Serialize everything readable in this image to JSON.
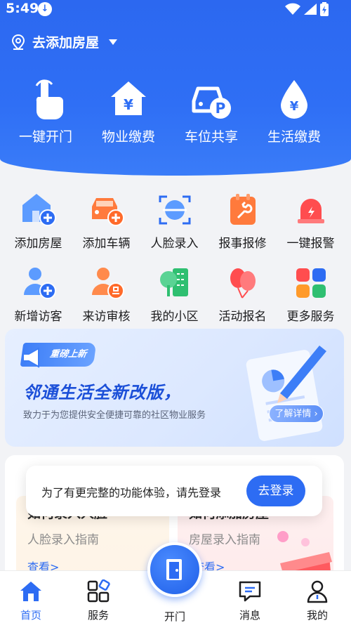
{
  "status": {
    "time": "5:49"
  },
  "header": {
    "location": "去添加房屋"
  },
  "quick_actions": [
    {
      "label": "一键开门",
      "icon": "hand-tap-icon"
    },
    {
      "label": "物业缴费",
      "icon": "house-yen-icon"
    },
    {
      "label": "车位共享",
      "icon": "car-parking-icon"
    },
    {
      "label": "生活缴费",
      "icon": "drop-yen-icon"
    }
  ],
  "services_row1": [
    {
      "label": "添加房屋",
      "icon": "add-house-icon"
    },
    {
      "label": "添加车辆",
      "icon": "add-car-icon"
    },
    {
      "label": "人脸录入",
      "icon": "face-scan-icon"
    },
    {
      "label": "报事报修",
      "icon": "repair-icon"
    },
    {
      "label": "一键报警",
      "icon": "alarm-icon"
    }
  ],
  "services_row2": [
    {
      "label": "新增访客",
      "icon": "add-visitor-icon"
    },
    {
      "label": "来访审核",
      "icon": "visitor-review-icon"
    },
    {
      "label": "我的小区",
      "icon": "community-icon"
    },
    {
      "label": "活动报名",
      "icon": "balloon-icon"
    },
    {
      "label": "更多服务",
      "icon": "more-apps-icon"
    }
  ],
  "banner": {
    "tag": "重磅上新",
    "title": "邻通生活全新改版，",
    "subtitle": "致力于为您提供安全便捷可靠的社区物业服务",
    "button": "了解详情"
  },
  "guide_cards": [
    {
      "title": "如何录入人脸",
      "subtitle": "人脸录入指南",
      "link": "查看>"
    },
    {
      "title": "如何添加房屋",
      "subtitle": "房屋录入指南",
      "link": "查看>"
    }
  ],
  "toast": {
    "message": "为了有更完整的功能体验，请先登录",
    "button": "去登录"
  },
  "tabbar": {
    "home": "首页",
    "services": "服务",
    "open": "开门",
    "messages": "消息",
    "mine": "我的"
  },
  "colors": {
    "brand": "#2d6cf3",
    "hero": "#2f6ff5"
  }
}
